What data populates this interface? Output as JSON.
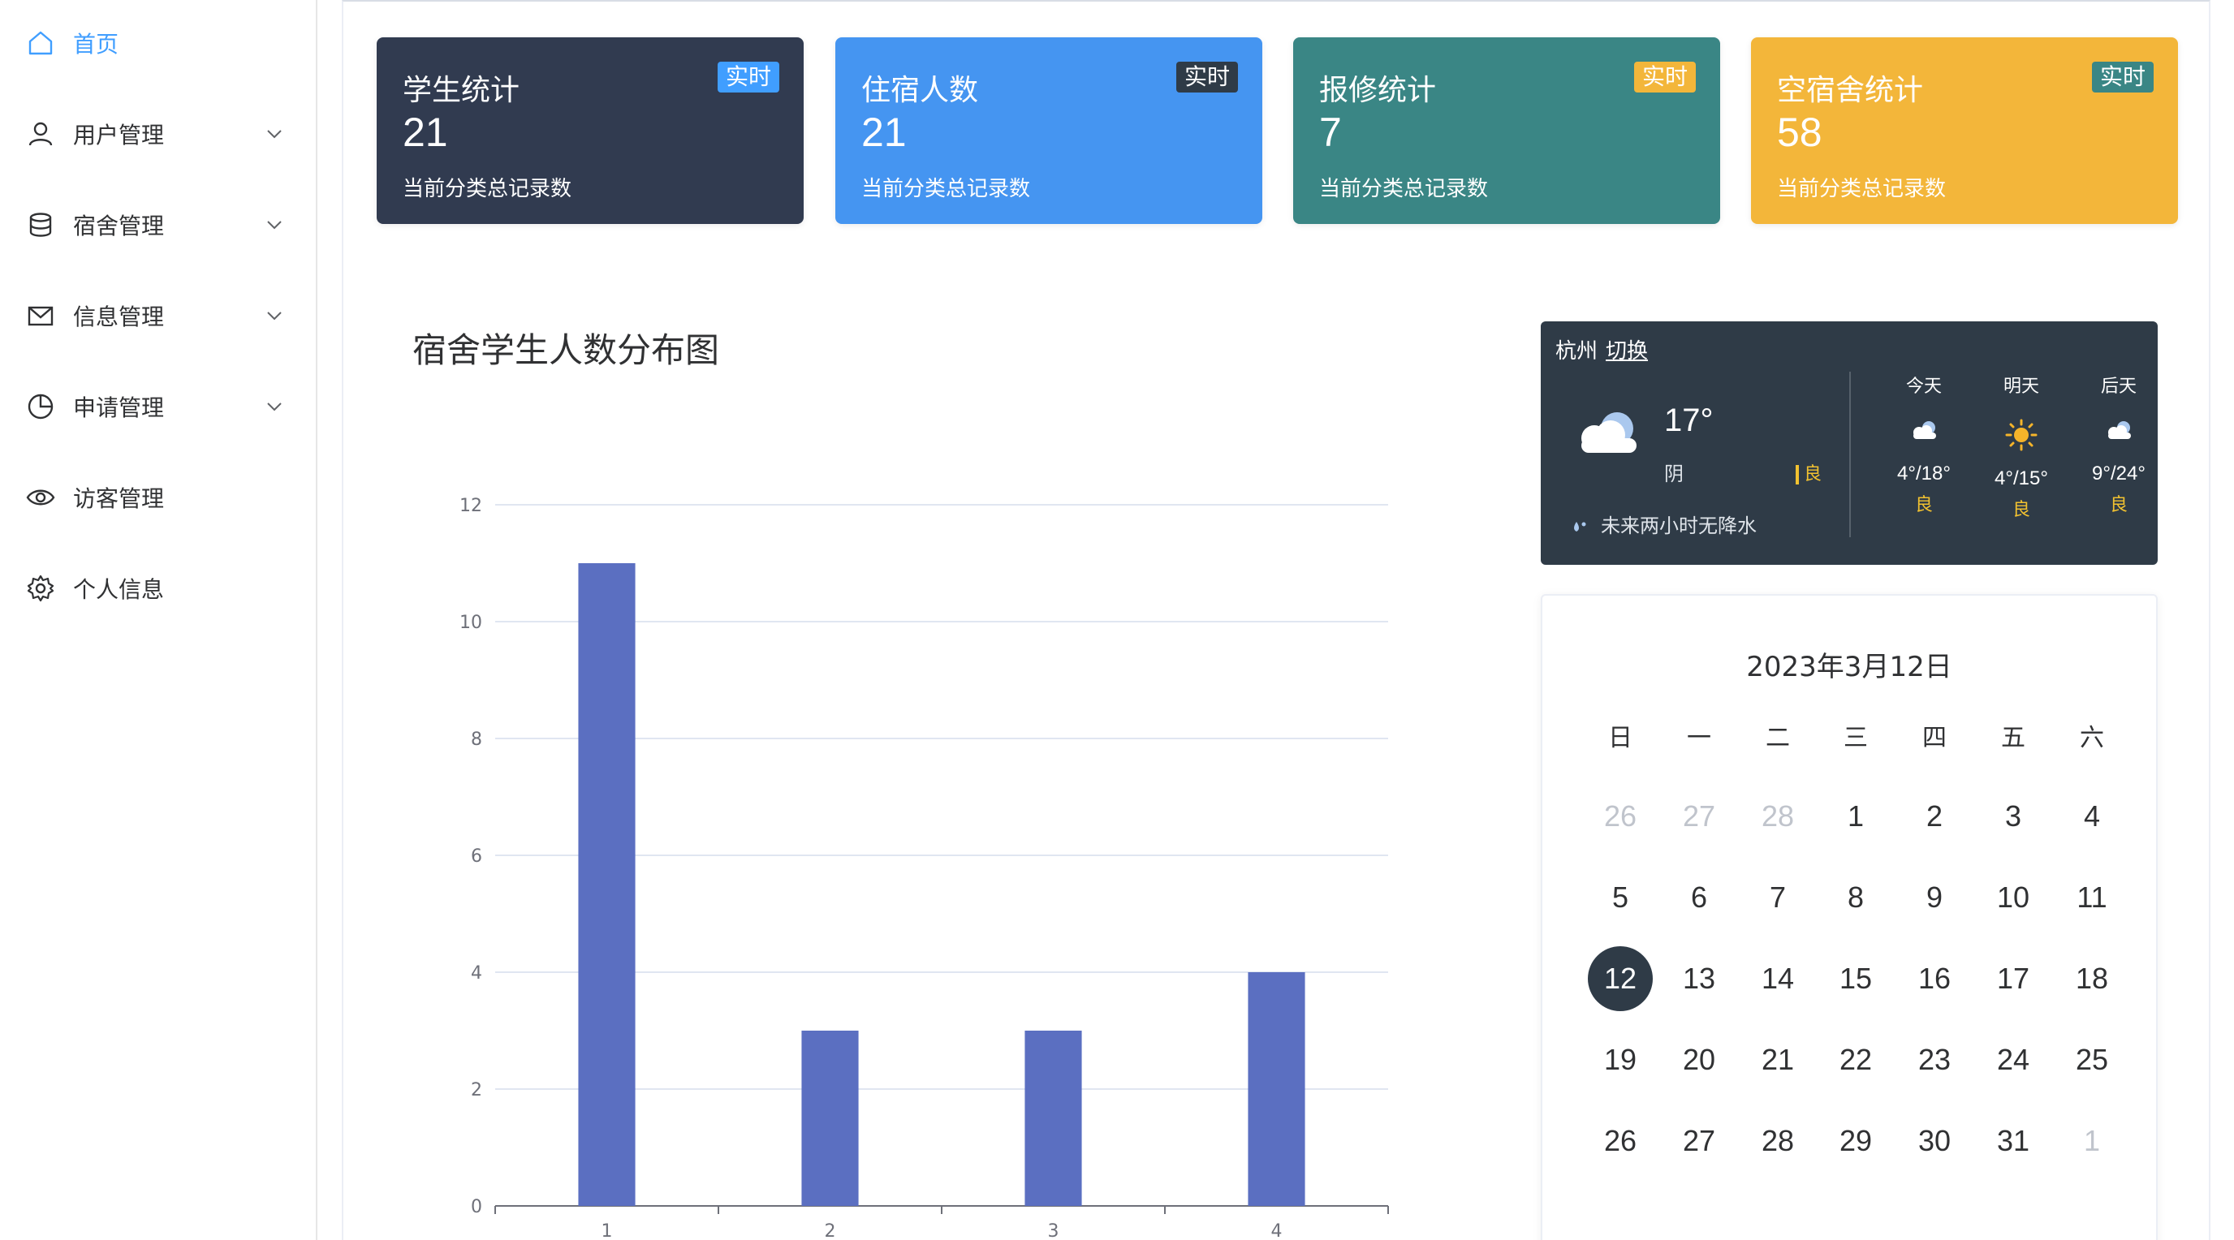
{
  "sidebar": {
    "items": [
      {
        "label": "首页",
        "icon": "home-icon",
        "active": true,
        "expandable": false
      },
      {
        "label": "用户管理",
        "icon": "user-icon",
        "active": false,
        "expandable": true
      },
      {
        "label": "宿舍管理",
        "icon": "database-icon",
        "active": false,
        "expandable": true
      },
      {
        "label": "信息管理",
        "icon": "message-icon",
        "active": false,
        "expandable": true
      },
      {
        "label": "申请管理",
        "icon": "pie-chart-icon",
        "active": false,
        "expandable": true
      },
      {
        "label": "访客管理",
        "icon": "eye-icon",
        "active": false,
        "expandable": false
      },
      {
        "label": "个人信息",
        "icon": "gear-icon",
        "active": false,
        "expandable": false
      }
    ]
  },
  "stats": [
    {
      "title": "学生统计",
      "value": "21",
      "sub": "当前分类总记录数",
      "badge": "实时",
      "bg": "#313b50",
      "badge_bg": "#409eff"
    },
    {
      "title": "住宿人数",
      "value": "21",
      "sub": "当前分类总记录数",
      "badge": "实时",
      "bg": "#4595f1",
      "badge_bg": "#2f3b47"
    },
    {
      "title": "报修统计",
      "value": "7",
      "sub": "当前分类总记录数",
      "badge": "实时",
      "bg": "#3a8685",
      "badge_bg": "#f3b63a"
    },
    {
      "title": "空宿舍统计",
      "value": "58",
      "sub": "当前分类总记录数",
      "badge": "实时",
      "bg": "#f3b63a",
      "badge_bg": "#3a8685"
    }
  ],
  "chart_title": "宿舍学生人数分布图",
  "chart_data": {
    "type": "bar",
    "categories": [
      "1",
      "2",
      "3",
      "4"
    ],
    "values": [
      11,
      3,
      3,
      4
    ],
    "yticks": [
      0,
      2,
      4,
      6,
      8,
      10,
      12
    ],
    "ylim": [
      0,
      12
    ],
    "grid": true,
    "color": "#5b6fc1"
  },
  "weather": {
    "city": "杭州",
    "switch_label": "切换",
    "temp": "17°",
    "condition": "阴",
    "aqi": "良",
    "rain": "未来两小时无降水",
    "forecast": [
      {
        "day": "今天",
        "icon": "cloud-icon",
        "range": "4°/18°",
        "aqi": "良"
      },
      {
        "day": "明天",
        "icon": "sun-icon",
        "range": "4°/15°",
        "aqi": "良"
      },
      {
        "day": "后天",
        "icon": "cloud-icon",
        "range": "9°/24°",
        "aqi": "良"
      }
    ]
  },
  "calendar": {
    "title": "2023年3月12日",
    "weekdays": [
      "日",
      "一",
      "二",
      "三",
      "四",
      "五",
      "六"
    ],
    "weeks": [
      [
        {
          "d": "26",
          "m": true
        },
        {
          "d": "27",
          "m": true
        },
        {
          "d": "28",
          "m": true
        },
        {
          "d": "1"
        },
        {
          "d": "2"
        },
        {
          "d": "3"
        },
        {
          "d": "4"
        }
      ],
      [
        {
          "d": "5"
        },
        {
          "d": "6"
        },
        {
          "d": "7"
        },
        {
          "d": "8"
        },
        {
          "d": "9"
        },
        {
          "d": "10"
        },
        {
          "d": "11"
        }
      ],
      [
        {
          "d": "12",
          "t": true
        },
        {
          "d": "13"
        },
        {
          "d": "14"
        },
        {
          "d": "15"
        },
        {
          "d": "16"
        },
        {
          "d": "17"
        },
        {
          "d": "18"
        }
      ],
      [
        {
          "d": "19"
        },
        {
          "d": "20"
        },
        {
          "d": "21"
        },
        {
          "d": "22"
        },
        {
          "d": "23"
        },
        {
          "d": "24"
        },
        {
          "d": "25"
        }
      ],
      [
        {
          "d": "26"
        },
        {
          "d": "27"
        },
        {
          "d": "28"
        },
        {
          "d": "29"
        },
        {
          "d": "30"
        },
        {
          "d": "31"
        },
        {
          "d": "1",
          "m": true
        }
      ]
    ]
  }
}
